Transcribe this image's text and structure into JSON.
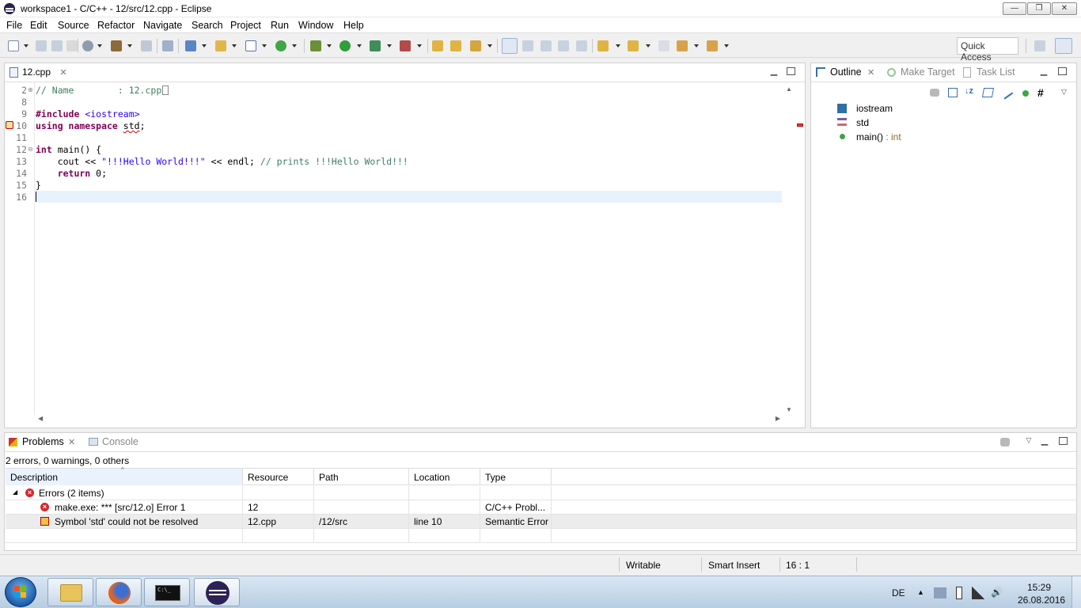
{
  "window": {
    "title": "workspace1 - C/C++ - 12/src/12.cpp - Eclipse",
    "min_label": "—",
    "max_label": "❐",
    "close_label": "✕"
  },
  "menu": [
    "File",
    "Edit",
    "Source",
    "Refactor",
    "Navigate",
    "Search",
    "Project",
    "Run",
    "Window",
    "Help"
  ],
  "toolbar": {
    "quick_access": "Quick Access"
  },
  "editor": {
    "tab_label": "12.cpp",
    "tab_close": "✕",
    "lines": [
      {
        "num": "2",
        "fold": "⊕"
      },
      {
        "num": "8",
        "fold": ""
      },
      {
        "num": "9",
        "fold": ""
      },
      {
        "num": "10",
        "fold": ""
      },
      {
        "num": "11",
        "fold": ""
      },
      {
        "num": "12",
        "fold": "⊖"
      },
      {
        "num": "13",
        "fold": ""
      },
      {
        "num": "14",
        "fold": ""
      },
      {
        "num": "15",
        "fold": ""
      },
      {
        "num": "16",
        "fold": ""
      }
    ],
    "code": {
      "l2": "// Name        : 12.cpp",
      "l9_dir": "#include",
      "l9_inc": " <iostream>",
      "l10_kw": "using namespace ",
      "l10_id": "std",
      "l10_end": ";",
      "l12_kw": "int",
      "l12_rest": " main() {",
      "l13_a": "    cout << ",
      "l13_str": "\"!!!Hello World!!!\"",
      "l13_b": " << endl; ",
      "l13_cm": "// prints !!!Hello World!!!",
      "l14_kw": "    return",
      "l14_rest": " 0;",
      "l15": "}"
    }
  },
  "outline": {
    "tabs": [
      "Outline",
      "Make Target",
      "Task List"
    ],
    "tab_close": "✕",
    "items": [
      {
        "label": "iostream",
        "type": ""
      },
      {
        "label": "std",
        "type": ""
      },
      {
        "label": "main()",
        "type": " : int"
      }
    ]
  },
  "problems": {
    "tabs": [
      "Problems",
      "Console"
    ],
    "tab_close": "✕",
    "summary": "2 errors, 0 warnings, 0 others",
    "columns": [
      "Description",
      "Resource",
      "Path",
      "Location",
      "Type"
    ],
    "group": "Errors (2 items)",
    "rows": [
      {
        "description": "make.exe: *** [src/12.o] Error 1",
        "resource": "12",
        "path": "",
        "location": "",
        "type": "C/C++ Probl..."
      },
      {
        "description": "Symbol 'std' could not be resolved",
        "resource": "12.cpp",
        "path": "/12/src",
        "location": "line 10",
        "type": "Semantic Error"
      }
    ]
  },
  "status": {
    "writable": "Writable",
    "insert_mode": "Smart Insert",
    "position": "16 : 1"
  },
  "taskbar": {
    "lang": "DE",
    "time": "15:29",
    "date": "26.08.2016",
    "cmd_label": "C:\\_"
  }
}
